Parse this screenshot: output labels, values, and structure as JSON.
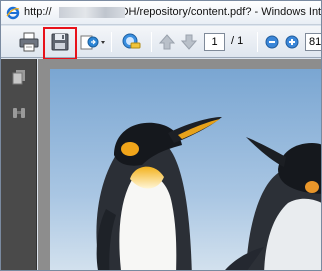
{
  "window": {
    "title_prefix": "http://",
    "title_suffix": "/DH/repository/content.pdf? - Windows Int"
  },
  "toolbar": {
    "page_current": "1",
    "page_total": "/ 1",
    "zoom_value": "81."
  },
  "colors": {
    "highlight": "#e8121b",
    "sidebar": "#4a4a4a",
    "sky": "#8fb6dc"
  },
  "icons": {
    "title": "ie-icon",
    "print": "print-icon",
    "save": "save-icon",
    "share": "share-icon",
    "find": "find-icon",
    "prev_page": "arrow-up-icon",
    "next_page": "arrow-down-icon",
    "zoom_out": "zoom-out-icon",
    "zoom_in": "zoom-in-icon",
    "pages_panel": "pages-icon",
    "attachments_panel": "binoculars-icon"
  },
  "document": {
    "content": "photo of two emperor penguins"
  }
}
